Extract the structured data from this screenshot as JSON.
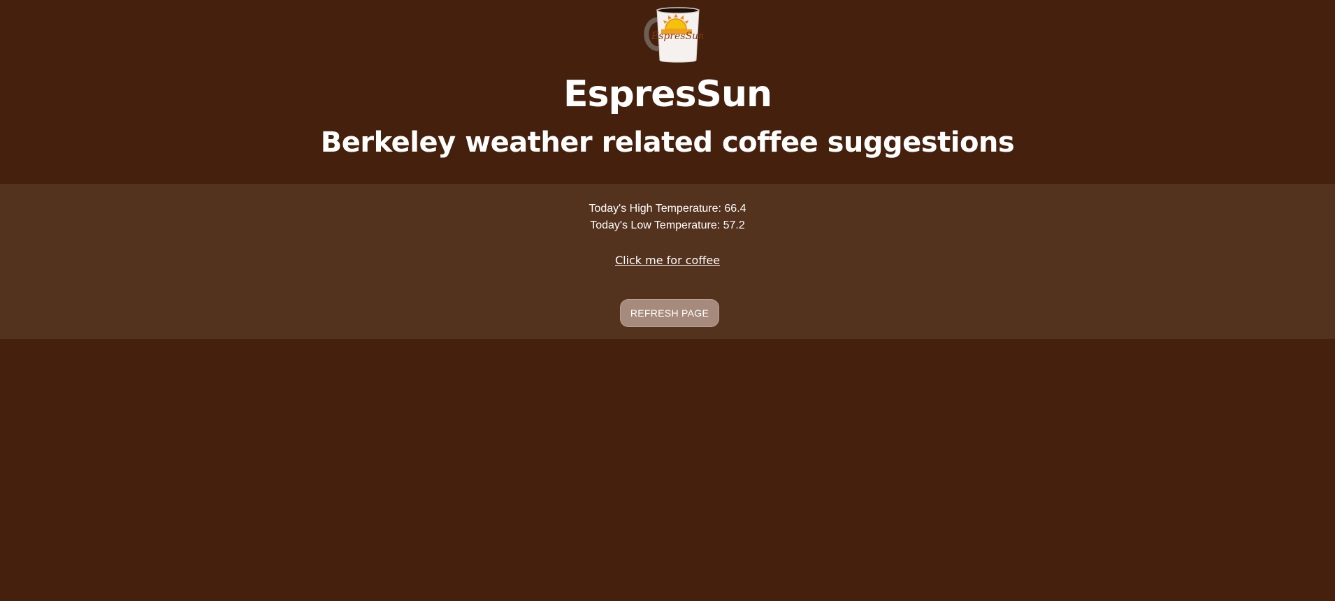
{
  "header": {
    "logo": {
      "icon": "coffee-mug-sun-logo-icon",
      "text": "EspresSun"
    },
    "title": "EspresSun",
    "subtitle": "Berkeley weather related coffee suggestions"
  },
  "weather": {
    "high_label": "Today's High Temperature: 66.4",
    "low_label": "Today's Low Temperature: 57.2"
  },
  "actions": {
    "coffee_link": "Click me for coffee",
    "refresh_button": "REFRESH PAGE"
  },
  "colors": {
    "background": "#45200c",
    "panel": "#53321e",
    "button": "#a68b7c",
    "text": "#ffffff",
    "sun_yellow": "#f5c20a",
    "sun_orange": "#e8891a"
  }
}
